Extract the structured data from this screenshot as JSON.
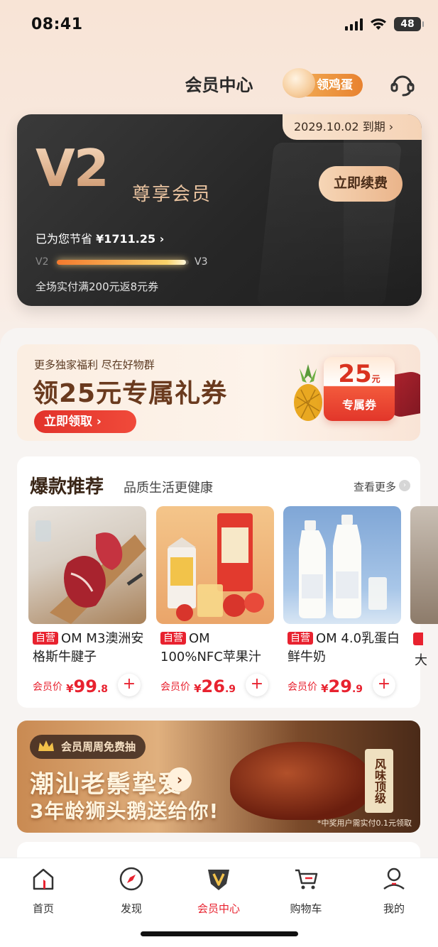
{
  "status": {
    "time": "08:41",
    "battery": "48"
  },
  "header": {
    "title": "会员中心",
    "egg_button": "领鸡蛋"
  },
  "member_card": {
    "expiry": "2029.10.02 到期 ›",
    "level": "V2",
    "level_name": "尊享会员",
    "renew_button": "立即续费",
    "savings_prefix": "已为您节省",
    "savings_amount": "¥1711.25 ›",
    "from_level": "V2",
    "to_level": "V3",
    "progress_fraction": 0.98,
    "benefit": "全场实付满200元返8元券"
  },
  "coupon_banner": {
    "subtitle": "更多独家福利 尽在好物群",
    "title": "领25元专属礼券",
    "claim_button": "立即领取 ›",
    "amount": "25",
    "unit": "元",
    "ticket_label": "专属券"
  },
  "recommend": {
    "title": "爆款推荐",
    "subtitle": "品质生活更健康",
    "more": "查看更多",
    "products": [
      {
        "tag": "自营",
        "name": "OM M3澳洲安格斯牛腱子",
        "price_label": "会员价",
        "currency": "¥",
        "price_int": "99",
        "price_dec": ".8"
      },
      {
        "tag": "自营",
        "name": "OM 100%NFC苹果汁",
        "price_label": "会员价",
        "currency": "¥",
        "price_int": "26",
        "price_dec": ".9"
      },
      {
        "tag": "自营",
        "name": "OM 4.0乳蛋白鲜牛奶",
        "price_label": "会员价",
        "currency": "¥",
        "price_int": "29",
        "price_dec": ".9"
      }
    ],
    "partial_text": "大"
  },
  "duck_banner": {
    "badge": "会员周周免费抽",
    "title_line1": "潮汕老鬃挚爱",
    "title_line2": "3年龄狮头鹅送给你!",
    "plaque": "风味顶级",
    "note": "*中奖用户需实付0.1元领取"
  },
  "tabs": [
    {
      "label": "首页",
      "icon": "home-icon"
    },
    {
      "label": "发现",
      "icon": "compass-icon"
    },
    {
      "label": "会员中心",
      "icon": "vip-icon"
    },
    {
      "label": "购物车",
      "icon": "cart-icon"
    },
    {
      "label": "我的",
      "icon": "profile-icon"
    }
  ],
  "colors": {
    "accent": "#e8222f",
    "card_dark": "#272727",
    "gold": "#e9bf98"
  }
}
